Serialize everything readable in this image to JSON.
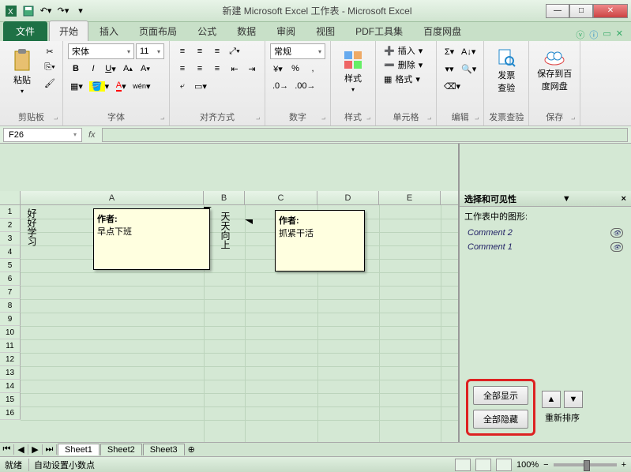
{
  "title": "新建 Microsoft Excel 工作表 - Microsoft Excel",
  "tabs": {
    "file": "文件",
    "home": "开始",
    "insert": "插入",
    "layout": "页面布局",
    "formula": "公式",
    "data": "数据",
    "review": "审阅",
    "view": "视图",
    "pdf": "PDF工具集",
    "baidu": "百度网盘"
  },
  "ribbon": {
    "clipboard": {
      "label": "剪贴板",
      "paste": "粘贴"
    },
    "font": {
      "label": "字体",
      "name": "宋体",
      "size": "11"
    },
    "align": {
      "label": "对齐方式"
    },
    "number": {
      "label": "数字",
      "format": "常规"
    },
    "styles": {
      "label": "样式",
      "btn": "样式"
    },
    "cells": {
      "label": "单元格",
      "insert": "插入",
      "delete": "删除",
      "format": "格式"
    },
    "editing": {
      "label": "编辑"
    },
    "invoice": {
      "label": "发票查验",
      "btn": "发票\n查验"
    },
    "save": {
      "label": "保存",
      "btn": "保存到百\n度网盘"
    }
  },
  "name_box": "F26",
  "columns": [
    "A",
    "B",
    "C",
    "D",
    "E"
  ],
  "cells": {
    "a_vertical": "好好学习",
    "b_vertical": "天天向上"
  },
  "comments": {
    "c1": {
      "author": "作者:",
      "text": "早点下班"
    },
    "c2": {
      "author": "作者:",
      "text": "抓紧干活"
    }
  },
  "pane": {
    "title": "选择和可见性",
    "subtitle": "工作表中的图形:",
    "items": [
      "Comment 2",
      "Comment 1"
    ],
    "show_all": "全部显示",
    "hide_all": "全部隐藏",
    "reorder": "重新排序"
  },
  "sheets": [
    "Sheet1",
    "Sheet2",
    "Sheet3"
  ],
  "status": {
    "ready": "就绪",
    "auto": "自动设置小数点",
    "zoom": "100%"
  }
}
